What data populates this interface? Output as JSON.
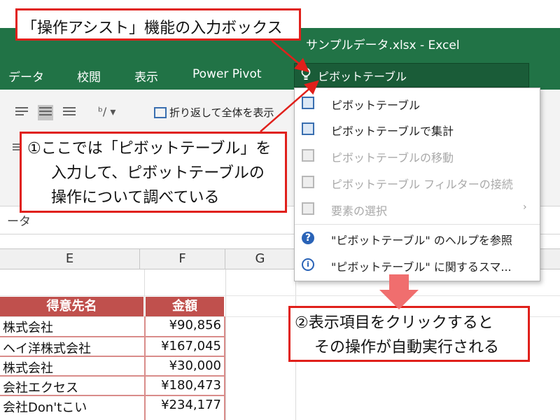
{
  "window": {
    "title": "サンプルデータ.xlsx - Excel"
  },
  "ribbon_tabs": [
    "データ",
    "校閲",
    "表示",
    "Power Pivot"
  ],
  "tell_me": {
    "value": "ピボットテーブル"
  },
  "ribbon": {
    "wrap_text_label": "折り返して全体を表示",
    "orientation_icon": "ab-orientation-icon"
  },
  "formula_bar": {
    "value": "ータ"
  },
  "columns": [
    "E",
    "F",
    "G"
  ],
  "table": {
    "headers": [
      "得意先名",
      "金額"
    ],
    "rows": [
      {
        "name": "株式会社",
        "amount": "¥90,856"
      },
      {
        "name": "ヘイ洋株式会社",
        "amount": "¥167,045"
      },
      {
        "name": "株式会社",
        "amount": "¥30,000"
      },
      {
        "name": "会社エクセス",
        "amount": "¥180,473"
      },
      {
        "name": "会社Don'tこい",
        "amount": "¥234,177"
      }
    ]
  },
  "dropdown": {
    "items": [
      {
        "label": "ピボットテーブル",
        "icon": "pivottable-icon",
        "enabled": true
      },
      {
        "label": "ピボットテーブルで集計",
        "icon": "pivottable-icon",
        "enabled": true
      },
      {
        "label": "ピボットテーブルの移動",
        "icon": "pivottable-move-icon",
        "enabled": false
      },
      {
        "label": "ピボットテーブル フィルターの接続",
        "icon": "filter-connection-icon",
        "enabled": false
      },
      {
        "label": "要素の選択",
        "icon": "select-element-icon",
        "enabled": false,
        "submenu": true
      },
      {
        "label": "\"ピボットテーブル\" のヘルプを参照",
        "icon": "help-icon",
        "enabled": true
      },
      {
        "label": "\"ピボットテーブル\" に関するスマ...",
        "icon": "smart-lookup-icon",
        "enabled": true
      }
    ]
  },
  "callouts": {
    "c1": "「操作アシスト」機能の入力ボックス",
    "c2": [
      "①ここでは「ピボットテーブル」を",
      "入力して、ピボットテーブルの",
      "操作について調べている"
    ],
    "c3": [
      "②表示項目をクリックすると",
      "その操作が自動実行される"
    ]
  },
  "colors": {
    "excel_green": "#217346",
    "header_red": "#c0504d",
    "callout_red": "#e0201b",
    "arrow_pink": "#f06e6e"
  }
}
